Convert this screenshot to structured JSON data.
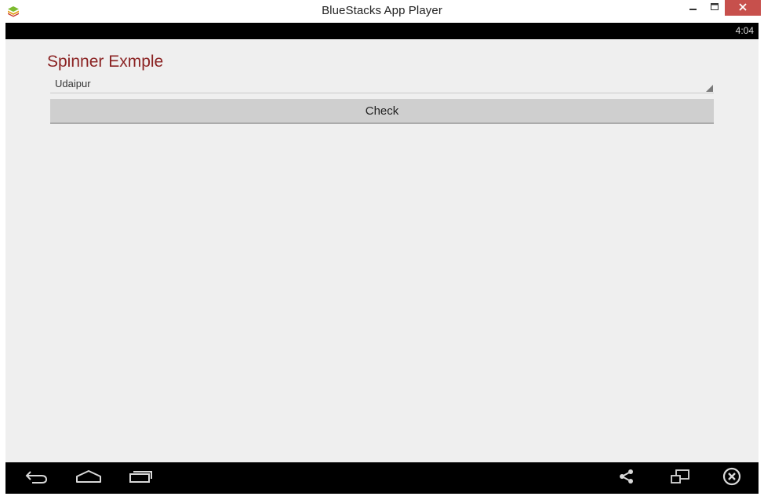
{
  "window": {
    "title": "BlueStacks App Player"
  },
  "statusbar": {
    "time": "4:04"
  },
  "app": {
    "title": "Spinner Exmple",
    "spinner_value": "Udaipur",
    "check_label": "Check"
  },
  "icons": {
    "app": "bluestacks-logo-icon",
    "minimize": "minimize-icon",
    "maximize": "maximize-icon",
    "close": "close-icon",
    "back": "back-icon",
    "home": "home-icon",
    "recents": "recents-icon",
    "share": "share-icon",
    "window": "window-icon",
    "exit": "close-circle-icon"
  },
  "colors": {
    "app_title": "#8b2323",
    "close_button": "#c7504c",
    "content_bg": "#efefef",
    "bar_bg": "#000000"
  }
}
